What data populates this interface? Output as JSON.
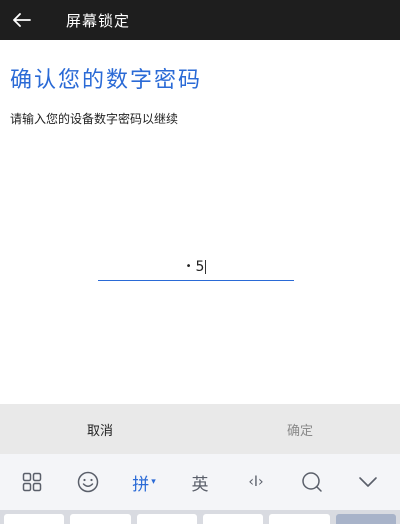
{
  "appbar": {
    "title": "屏幕锁定",
    "back_icon": "arrow-left-icon"
  },
  "main": {
    "heading": "确认您的数字密码",
    "instruction": "请输入您的设备数字密码以继续",
    "pin_field": {
      "masked_value": "•",
      "visible_digit": "5"
    }
  },
  "actions": {
    "cancel_label": "取消",
    "confirm_label": "确定"
  },
  "ime_toolbar": {
    "items": [
      {
        "name": "grid-icon",
        "glyph": ""
      },
      {
        "name": "emoji-icon",
        "glyph": ""
      },
      {
        "name": "pinyin-key",
        "glyph": "拼"
      },
      {
        "name": "english-key",
        "glyph": "英"
      },
      {
        "name": "cursor-icon",
        "glyph": "‹I›"
      },
      {
        "name": "search-icon",
        "glyph": ""
      },
      {
        "name": "collapse-icon",
        "glyph": ""
      }
    ],
    "active_color": "#2a6ad6"
  }
}
